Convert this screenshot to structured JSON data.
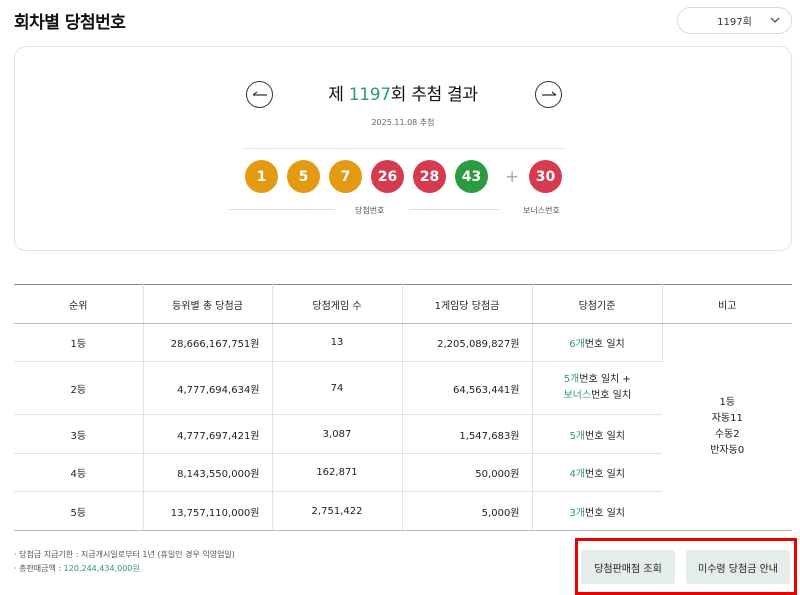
{
  "page": {
    "title": "회차별 당첨번호"
  },
  "round_select": {
    "value": "1197회"
  },
  "draw": {
    "prefix": "제 ",
    "round": "1197",
    "suffix": "회 추첨 결과",
    "date": "2025.11.08 추첨",
    "winning_numbers": [
      "1",
      "5",
      "7",
      "26",
      "28",
      "43"
    ],
    "bonus_number": "30",
    "winning_label": "당첨번호",
    "bonus_label": "보너스번호",
    "plus_sign": "+"
  },
  "colors": {
    "yellow": "#e39a12",
    "red": "#d63a4f",
    "green": "#2b9b3f",
    "accent_text": "#2e9b6b",
    "highlight_border": "#ee0000"
  },
  "table": {
    "headers": [
      "순위",
      "등위별 총 당첨금",
      "당첨게임 수",
      "1게임당 당첨금",
      "당첨기준",
      "비고"
    ],
    "rows": [
      {
        "rank": "1등",
        "total": "28,666,167,751원",
        "games": "13",
        "per_game": "2,205,089,827원",
        "criteria_1_num": "6개",
        "criteria_1_text": "번호 일치"
      },
      {
        "rank": "2등",
        "total": "4,777,694,634원",
        "games": "74",
        "per_game": "64,563,441원",
        "criteria_1_num": "5개",
        "criteria_1_text": "번호 일치 +",
        "criteria_2_num": "보너스",
        "criteria_2_text": "번호 일치"
      },
      {
        "rank": "3등",
        "total": "4,777,697,421원",
        "games": "3,087",
        "per_game": "1,547,683원",
        "criteria_1_num": "5개",
        "criteria_1_text": "번호 일치"
      },
      {
        "rank": "4등",
        "total": "8,143,550,000원",
        "games": "162,871",
        "per_game": "50,000원",
        "criteria_1_num": "4개",
        "criteria_1_text": "번호 일치"
      },
      {
        "rank": "5등",
        "total": "13,757,110,000원",
        "games": "2,751,422",
        "per_game": "5,000원",
        "criteria_1_num": "3개",
        "criteria_1_text": "번호 일치"
      }
    ],
    "note_lines": [
      "1등",
      "자동11",
      "수동2",
      "반자동0"
    ]
  },
  "footnotes": {
    "line1": "· 당첨금 지급기한 : 지급개시일로부터 1년 (휴일인 경우 익영업일)",
    "line2_prefix": "· 총판매금액 : ",
    "line2_value": "120,244,434,000원"
  },
  "buttons": {
    "store_lookup": "당첨판매점 조회",
    "unclaimed": "미수령 당첨금 안내"
  }
}
